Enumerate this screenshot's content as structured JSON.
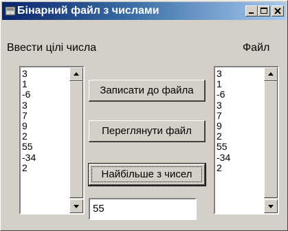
{
  "window": {
    "title": "Бінарний файл з числами",
    "controls": [
      "minimize-icon",
      "maximize-icon",
      "close-icon"
    ]
  },
  "labels": {
    "input_label": "Ввести цілі числа",
    "file_label": "Файл"
  },
  "input_list": {
    "items": [
      "3",
      "1",
      "-6",
      "3",
      "7",
      "9",
      "2",
      "55",
      "-34",
      "2"
    ]
  },
  "file_list": {
    "items": [
      "3",
      "1",
      "-6",
      "3",
      "7",
      "9",
      "2",
      "55",
      "-34",
      "2"
    ]
  },
  "buttons": {
    "write": "Записати до файла",
    "view": "Переглянути файл",
    "max": "Найбільше з чисел"
  },
  "result": {
    "value": "55"
  },
  "colors": {
    "title_gradient_start": "#0a246a",
    "title_gradient_end": "#a6caf0",
    "face": "#d4d0c8"
  }
}
